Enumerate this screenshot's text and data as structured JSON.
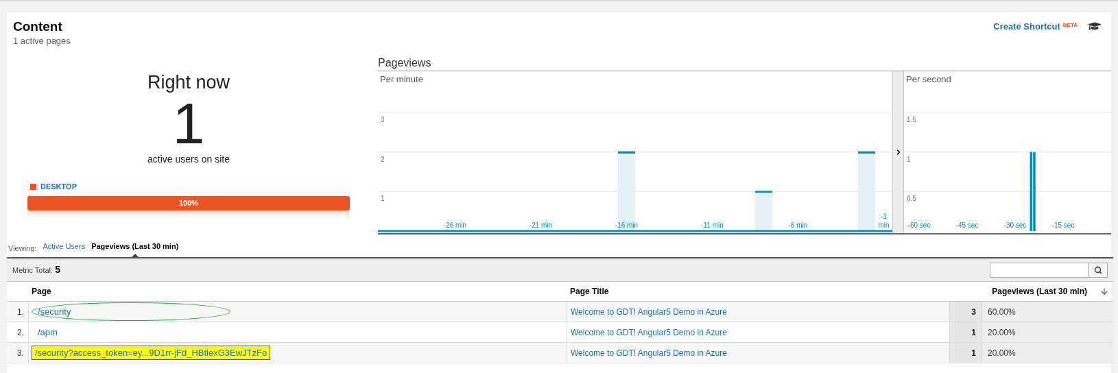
{
  "header": {
    "title": "Content",
    "subtitle": "1 active pages",
    "shortcut": {
      "label": "Create Shortcut",
      "badge": "BETA"
    }
  },
  "right_now": {
    "title": "Right now",
    "count": "1",
    "caption": "active users on site",
    "devices": [
      {
        "label": "DESKTOP",
        "color": "#eb5424",
        "level": 1,
        "reading": "100%"
      }
    ]
  },
  "pageviews": {
    "title": "Pageviews",
    "per_minute": {
      "chart_data": {
        "type": "bar",
        "title": "Per minute",
        "grid": true,
        "x": [
          -30,
          -29,
          -28,
          -27,
          -26,
          -25,
          -24,
          -23,
          -22,
          -21,
          -20,
          -19,
          -18,
          -17,
          -16,
          -15,
          -14,
          -13,
          -12,
          -11,
          -10,
          -9,
          -8,
          -7,
          -6,
          -5,
          -4,
          -3,
          -2,
          -1
        ],
        "values": [
          0,
          0,
          0,
          0,
          0,
          0,
          0,
          0,
          0,
          0,
          0,
          0,
          0,
          0,
          2,
          0,
          0,
          0,
          0,
          0,
          0,
          0,
          1,
          0,
          0,
          0,
          0,
          0,
          2,
          0
        ],
        "xlim": [
          -30.5,
          -0.5
        ],
        "ylim": [
          0,
          3
        ],
        "yticks": [
          1,
          2,
          3
        ],
        "xticks": [
          {
            "value": -26,
            "label": "-26 min"
          },
          {
            "value": -21,
            "label": "-21 min"
          },
          {
            "value": -16,
            "label": "-16 min"
          },
          {
            "value": -11,
            "label": "-11 min"
          },
          {
            "value": -6,
            "label": "-6 min"
          },
          {
            "value": -1,
            "label": "-1 min"
          }
        ]
      }
    },
    "per_second": {
      "chart_data": {
        "type": "bar",
        "title": "Per second",
        "grid": true,
        "x": [
          -25,
          -24
        ],
        "values": [
          1,
          1
        ],
        "xlim": [
          -60,
          0
        ],
        "ylim": [
          0,
          1.5
        ],
        "yticks": [
          0.5,
          1,
          1.5
        ],
        "xticks": [
          {
            "value": -60,
            "label": "-60 sec"
          },
          {
            "value": -45,
            "label": "-45 sec"
          },
          {
            "value": -30,
            "label": "-30 sec"
          },
          {
            "value": -15,
            "label": "-15 sec"
          }
        ]
      }
    }
  },
  "viewing": {
    "label": "Viewing:",
    "tabs": [
      {
        "label": "Active Users",
        "selected": false
      },
      {
        "label": "Pageviews (Last 30 min)",
        "selected": true
      }
    ]
  },
  "table": {
    "metric_label": "Metric Total:",
    "metric_value": "5",
    "columns": [
      {
        "label": "Page"
      },
      {
        "label": "Page Title"
      },
      {
        "label": "Pageviews (Last 30 min)",
        "sorted": true
      }
    ],
    "rows": [
      {
        "index": "1.",
        "page": "/security",
        "circled": true,
        "highlighted": false,
        "title": "Welcome to GDT! Angular5 Demo in Azure",
        "count": "3",
        "percent": "60.00%"
      },
      {
        "index": "2.",
        "page": "/apm",
        "circled": false,
        "highlighted": false,
        "title": "Welcome to GDT! Angular5 Demo in Azure",
        "count": "1",
        "percent": "20.00%"
      },
      {
        "index": "3.",
        "page": "/security?access_token=ey...9D1rr-jFd_HBtlexG3EwJTzFo",
        "circled": false,
        "highlighted": true,
        "title": "Welcome to GDT! Angular5 Demo in Azure",
        "count": "1",
        "percent": "20.00%"
      }
    ]
  }
}
